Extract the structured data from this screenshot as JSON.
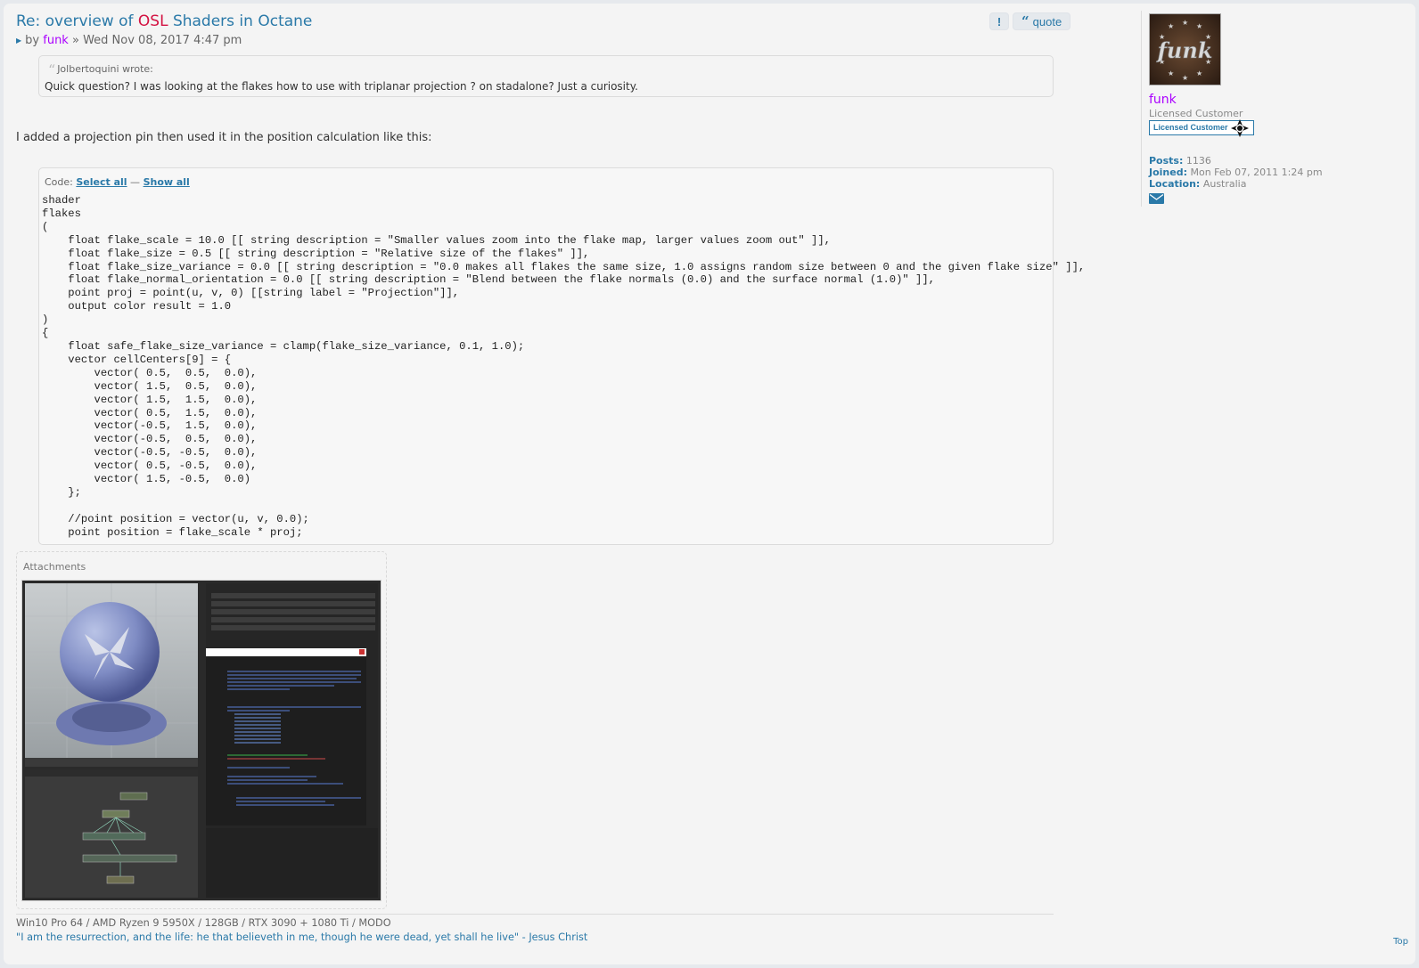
{
  "post": {
    "title_pre": "Re: overview of ",
    "title_hl": "OSL",
    "title_post": " Shaders in Octane",
    "by": "by",
    "author": "funk",
    "date": "» Wed Nov 08, 2017 4:47 pm",
    "report_label": "!",
    "quote_label": "quote",
    "quote_cite": "Jolbertoquini wrote:",
    "quote_text": "Quick question? I was looking at the flakes how to use with triplanar projection ? on stadalone? Just a curiosity.",
    "body_text": "I added a projection pin then used it in the position calculation like this:",
    "code_label": "Code: ",
    "select_all": "Select all",
    "code_sep": " — ",
    "show_all": "Show all",
    "code": "shader\nflakes\n(\n    float flake_scale = 10.0 [[ string description = \"Smaller values zoom into the flake map, larger values zoom out\" ]],\n    float flake_size = 0.5 [[ string description = \"Relative size of the flakes\" ]],\n    float flake_size_variance = 0.0 [[ string description = \"0.0 makes all flakes the same size, 1.0 assigns random size between 0 and the given flake size\" ]],\n    float flake_normal_orientation = 0.0 [[ string description = \"Blend between the flake normals (0.0) and the surface normal (1.0)\" ]],\n    point proj = point(u, v, 0) [[string label = \"Projection\"]],\n    output color result = 1.0\n)\n{\n    float safe_flake_size_variance = clamp(flake_size_variance, 0.1, 1.0);\n    vector cellCenters[9] = {\n        vector( 0.5,  0.5,  0.0),\n        vector( 1.5,  0.5,  0.0),\n        vector( 1.5,  1.5,  0.0),\n        vector( 0.5,  1.5,  0.0),\n        vector(-0.5,  1.5,  0.0),\n        vector(-0.5,  0.5,  0.0),\n        vector(-0.5, -0.5,  0.0),\n        vector( 0.5, -0.5,  0.0),\n        vector( 1.5, -0.5,  0.0)\n    };\n\n    //point position = vector(u, v, 0.0);\n    point position = flake_scale * proj;",
    "attachments_label": "Attachments",
    "signature_specs": "Win10 Pro 64 / AMD Ryzen 9 5950X / 128GB / RTX 3090 + 1080 Ti / MODO",
    "signature_quote": "\"I am the resurrection, and the life: he that believeth in me, though he were dead, yet shall he live\" - Jesus Christ",
    "top_label": "Top"
  },
  "profile": {
    "avatar_text": "funk",
    "name": "funk",
    "rank": "Licensed Customer",
    "rank_badge": "Licensed Customer",
    "posts_label": "Posts:",
    "posts_value": " 1136",
    "joined_label": "Joined:",
    "joined_value": " Mon Feb 07, 2011 1:24 pm",
    "location_label": "Location:",
    "location_value": " Australia"
  },
  "colors": {
    "link": "#2a79a8",
    "username": "#aa00ff",
    "highlight": "#d31141"
  },
  "icons": [
    "post-arrow-icon",
    "report-icon",
    "quote-icon",
    "email-icon",
    "octane-logo-icon"
  ]
}
